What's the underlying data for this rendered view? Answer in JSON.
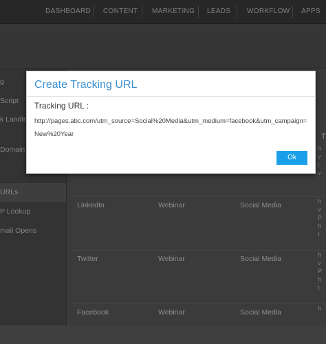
{
  "top_nav": {
    "items": [
      "DASHBOARD",
      "CONTENT",
      "MARKETING",
      "LEADS",
      "WORKFLOW",
      "APPS"
    ]
  },
  "sidebar": {
    "items": [
      {
        "label": "g"
      },
      {
        "label": "Script"
      },
      {
        "label": "k Landing"
      },
      {
        "label": "Domain"
      },
      {
        "label": "URLs"
      },
      {
        "label": "P Lookup"
      },
      {
        "label": "mail Opens"
      }
    ]
  },
  "table": {
    "rows": [
      {
        "source": "LinkedIn",
        "campaign": "Webinar",
        "medium": "Social Media",
        "vertical": [
          "h",
          "v",
          "P",
          "h",
          "t"
        ]
      },
      {
        "source": "Twitter",
        "campaign": "Webinar",
        "medium": "Social Media",
        "vertical": [
          "h",
          "v",
          "P",
          "h",
          "t"
        ]
      },
      {
        "source": "Facebook",
        "campaign": "Webinar",
        "medium": "Social Media",
        "vertical": [
          "h"
        ]
      }
    ],
    "right_col_letter": "T",
    "right_col_values": [
      "h",
      "v",
      "l",
      "v"
    ]
  },
  "modal": {
    "title": "Create Tracking URL",
    "label": "Tracking URL :",
    "url": "http://pages.abc.com/utm_source=Social%20Media&utm_medium=facebook&utm_campaign=New%20Year",
    "ok_label": "Ok",
    "accent": "#3a8fd0",
    "button_color": "#1aa0e8"
  }
}
